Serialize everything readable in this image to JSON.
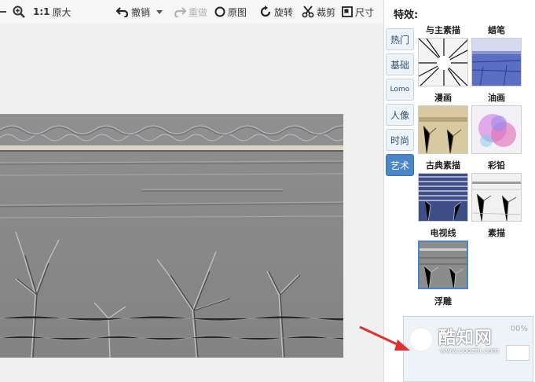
{
  "toolbar": {
    "original_size_prefix": "1:1",
    "original_size_label": "原大",
    "undo_label": "撤销",
    "redo_label": "重做",
    "restore_label": "原图",
    "rotate_label": "旋转",
    "crop_label": "裁剪",
    "size_label": "尺寸"
  },
  "panel": {
    "title": "特效:",
    "tabs": [
      {
        "label": "热门"
      },
      {
        "label": "基础"
      },
      {
        "label": "Lomo"
      },
      {
        "label": "人像"
      },
      {
        "label": "时尚"
      },
      {
        "label": "艺术",
        "active": true
      }
    ],
    "effects": [
      {
        "label": "与主素描"
      },
      {
        "label": "蜡笔"
      },
      {
        "label": "漫画"
      },
      {
        "label": "油画"
      },
      {
        "label": "古典素描"
      },
      {
        "label": "彩铅"
      },
      {
        "label": "电视线"
      },
      {
        "label": "素描"
      },
      {
        "label": "浮雕",
        "selected": true
      }
    ]
  },
  "dialog": {
    "percent_text": "00%"
  },
  "watermark": {
    "name": "酷知网",
    "url": "www.coozhi.com"
  },
  "colors": {
    "accent": "#4a86c8",
    "tab_bg": "#eef3f8",
    "emboss_gray": "#8a8a8a",
    "arrow": "#e03030"
  }
}
